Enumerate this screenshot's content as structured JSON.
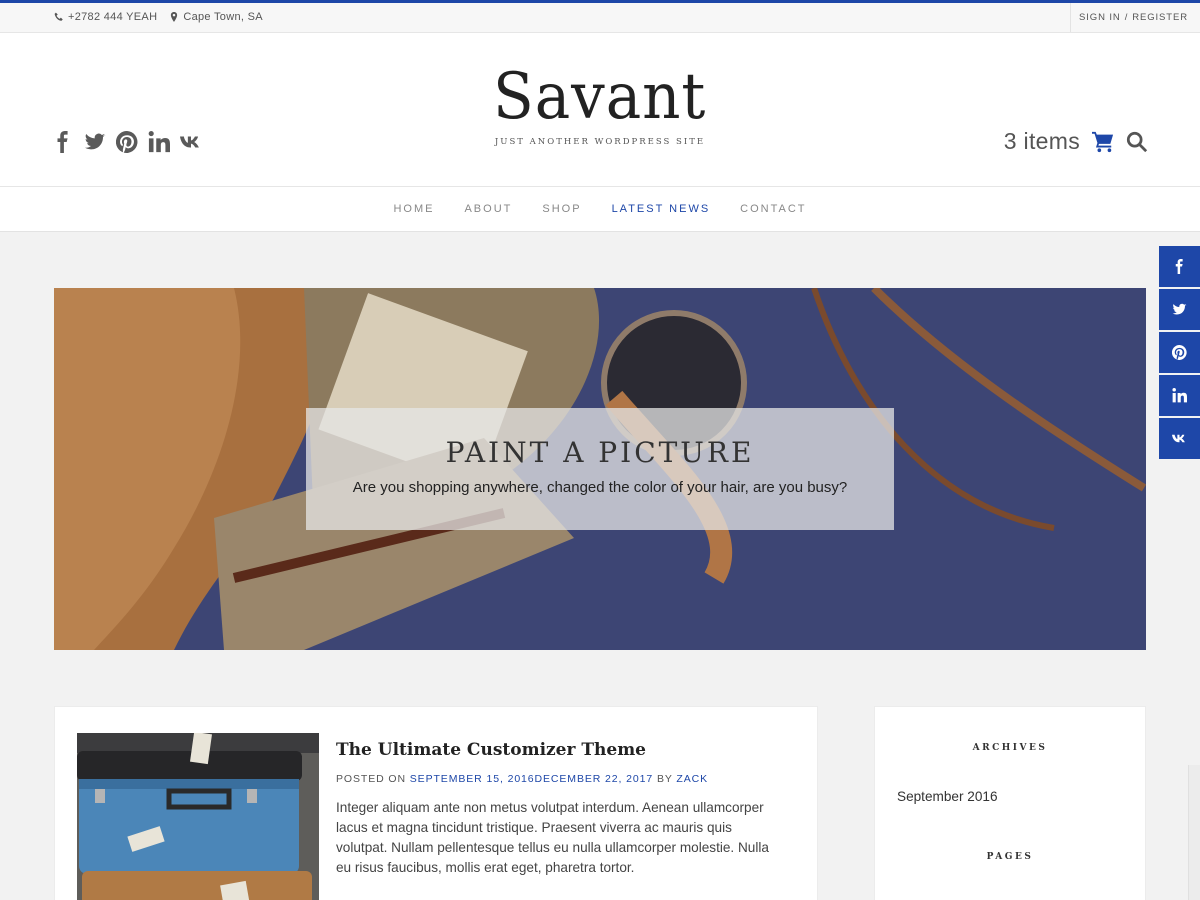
{
  "topbar": {
    "phone": "+2782 444 YEAH",
    "location": "Cape Town, SA",
    "sign_in": "SIGN IN",
    "separator": "/",
    "register": "REGISTER"
  },
  "header": {
    "site_title": "Savant",
    "tagline": "JUST ANOTHER WORDPRESS SITE",
    "cart_count": "3 items",
    "social_icons": [
      "facebook-icon",
      "twitter-icon",
      "pinterest-icon",
      "linkedin-icon",
      "vk-icon"
    ]
  },
  "nav": {
    "items": [
      {
        "label": "HOME"
      },
      {
        "label": "ABOUT"
      },
      {
        "label": "SHOP"
      },
      {
        "label": "LATEST NEWS"
      },
      {
        "label": "CONTACT"
      }
    ],
    "active": "LATEST NEWS"
  },
  "hero": {
    "heading": "PAINT A PICTURE",
    "subheading": "Are you shopping anywhere, changed the color of your hair, are you busy?"
  },
  "post": {
    "title": "The Ultimate Customizer Theme",
    "meta_prefix": "POSTED ON",
    "date": "SEPTEMBER 15, 2016DECEMBER 22, 2017",
    "by": "BY",
    "author": "ZACK",
    "excerpt": "Integer aliquam ante non metus volutpat interdum. Aenean ullamcorper lacus et magna tincidunt tristique. Praesent viverra ac mauris quis volutpat. Nullam pellentesque tellus eu nulla ullamcorper molestie. Nulla eu risus faucibus, mollis erat eget, pharetra tortor."
  },
  "sidebar": {
    "archives_title": "ARCHIVES",
    "archive_link": "September 2016",
    "pages_title": "PAGES"
  },
  "colors": {
    "accent": "#1e47a8",
    "background": "#f2f2f2"
  }
}
